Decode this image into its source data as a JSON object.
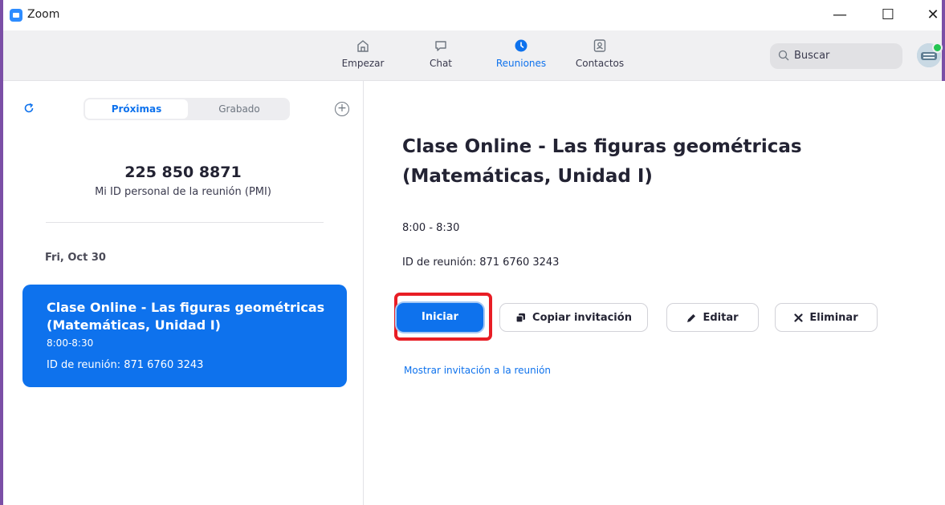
{
  "window": {
    "title": "Zoom",
    "controls": {
      "minimize": "—",
      "maximize": "☐",
      "close": "✕"
    }
  },
  "toolbar": {
    "nav": [
      {
        "label": "Empezar",
        "icon": "home-icon"
      },
      {
        "label": "Chat",
        "icon": "chat-bubble-icon"
      },
      {
        "label": "Reuniones",
        "icon": "clock-icon",
        "active": true
      },
      {
        "label": "Contactos",
        "icon": "contact-card-icon"
      }
    ],
    "search_placeholder": "Buscar"
  },
  "left": {
    "tabs": {
      "upcoming": "Próximas",
      "recorded": "Grabado"
    },
    "pmi_number": "225 850 8871",
    "pmi_label": "Mi ID personal de la reunión (PMI)",
    "date_header": "Fri, Oct 30",
    "card": {
      "title": "Clase Online - Las figuras geométricas (Matemáticas, Unidad I)",
      "time": "8:00-8:30",
      "meeting_id": "ID de reunión: 871 6760 3243"
    }
  },
  "detail": {
    "title": "Clase Online - Las figuras geométricas (Matemáticas, Unidad I)",
    "time": "8:00 - 8:30",
    "meeting_id": "ID de reunión: 871 6760 3243",
    "buttons": {
      "start": "Iniciar",
      "copy": "Copiar invitación",
      "edit": "Editar",
      "delete": "Eliminar"
    },
    "show_invitation": "Mostrar invitación a la reunión"
  },
  "colors": {
    "accent": "#0e72ed",
    "highlight": "#e81d25",
    "window_border": "#7b4fa6",
    "presence": "#23c552"
  }
}
